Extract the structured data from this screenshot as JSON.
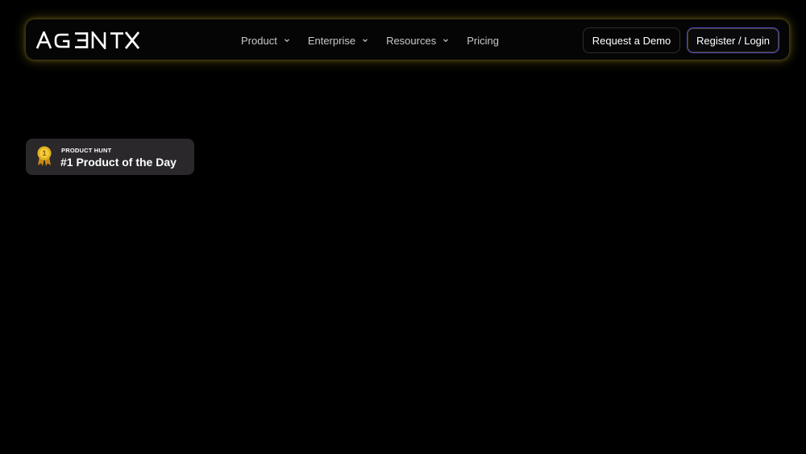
{
  "brand": {
    "logo_text": "AGENTX",
    "accent_glow": "#d2b428"
  },
  "nav": {
    "items": [
      {
        "label": "Product",
        "has_dropdown": true,
        "icon": "chevron-down-icon"
      },
      {
        "label": "Enterprise",
        "has_dropdown": true,
        "icon": "chevron-down-icon"
      },
      {
        "label": "Resources",
        "has_dropdown": true,
        "icon": "chevron-down-icon"
      },
      {
        "label": "Pricing",
        "has_dropdown": false
      }
    ]
  },
  "actions": {
    "demo_label": "Request a Demo",
    "register_label": "Register / Login",
    "register_border": "#4a47c8"
  },
  "badge": {
    "kicker": "PRODUCT HUNT",
    "title": "#1 Product of the Day",
    "medal_number": "1",
    "icon": "medal-icon",
    "medal_color": "#e8b923"
  }
}
